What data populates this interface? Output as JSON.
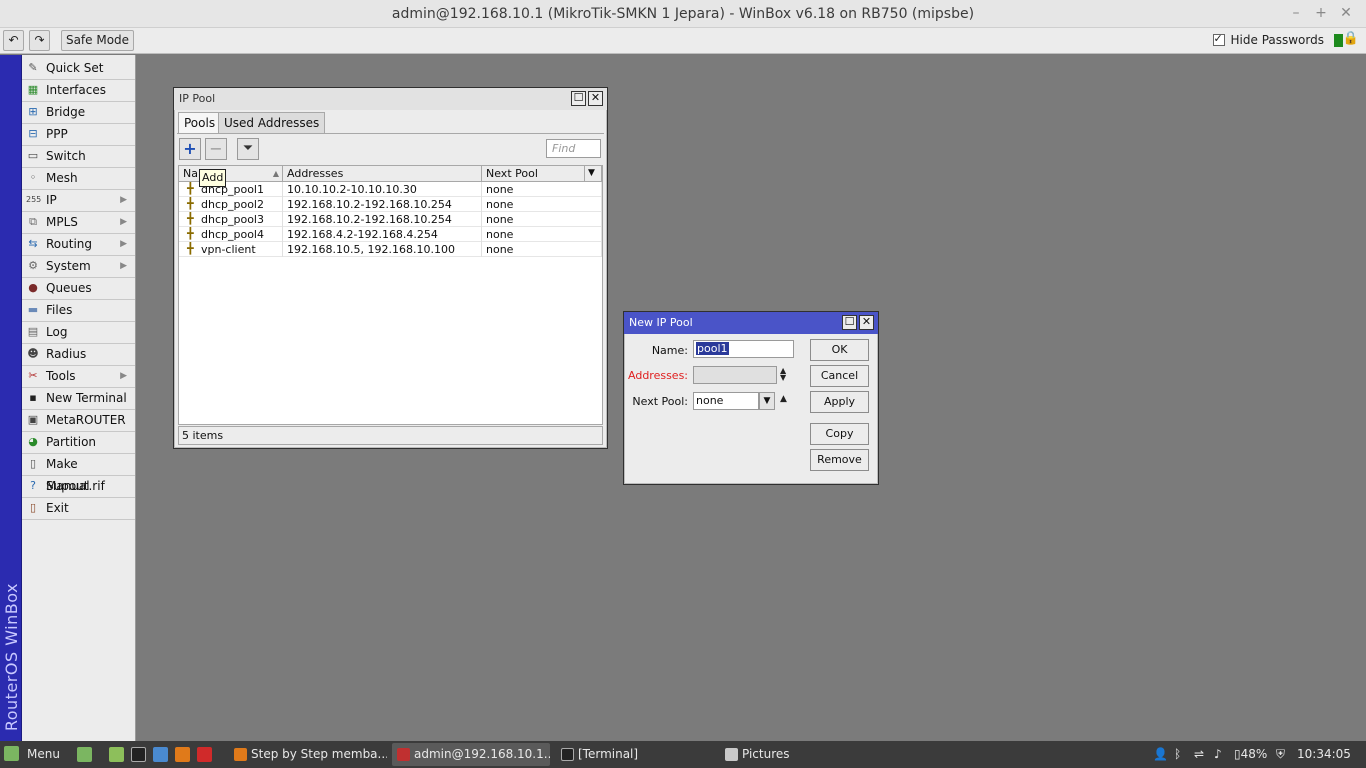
{
  "window": {
    "title": "admin@192.168.10.1 (MikroTik-SMKN 1 Jepara) - WinBox v6.18 on RB750 (mipsbe)"
  },
  "toolbar": {
    "undo_icon": "undo-icon",
    "redo_icon": "redo-icon",
    "safe_mode_label": "Safe Mode",
    "hide_passwords_label": "Hide Passwords",
    "hide_passwords_checked": true
  },
  "sidebar": {
    "brand": "RouterOS WinBox",
    "items": [
      {
        "label": "Quick Set",
        "icon": "wand-icon",
        "arrow": false
      },
      {
        "label": "Interfaces",
        "icon": "interfaces-icon",
        "arrow": false
      },
      {
        "label": "Bridge",
        "icon": "bridge-icon",
        "arrow": false
      },
      {
        "label": "PPP",
        "icon": "ppp-icon",
        "arrow": false
      },
      {
        "label": "Switch",
        "icon": "switch-icon",
        "arrow": false
      },
      {
        "label": "Mesh",
        "icon": "mesh-icon",
        "arrow": false
      },
      {
        "label": "IP",
        "icon": "ip-icon",
        "arrow": true
      },
      {
        "label": "MPLS",
        "icon": "mpls-icon",
        "arrow": true
      },
      {
        "label": "Routing",
        "icon": "routing-icon",
        "arrow": true
      },
      {
        "label": "System",
        "icon": "gear-icon",
        "arrow": true
      },
      {
        "label": "Queues",
        "icon": "queues-icon",
        "arrow": false
      },
      {
        "label": "Files",
        "icon": "folder-icon",
        "arrow": false
      },
      {
        "label": "Log",
        "icon": "log-icon",
        "arrow": false
      },
      {
        "label": "Radius",
        "icon": "radius-icon",
        "arrow": false
      },
      {
        "label": "Tools",
        "icon": "tools-icon",
        "arrow": true
      },
      {
        "label": "New Terminal",
        "icon": "terminal-icon",
        "arrow": false
      },
      {
        "label": "MetaROUTER",
        "icon": "metarouter-icon",
        "arrow": false
      },
      {
        "label": "Partition",
        "icon": "partition-icon",
        "arrow": false
      },
      {
        "label": "Make Supout.rif",
        "icon": "document-icon",
        "arrow": false
      },
      {
        "label": "Manual",
        "icon": "help-icon",
        "arrow": false
      },
      {
        "label": "Exit",
        "icon": "exit-icon",
        "arrow": false
      }
    ]
  },
  "ip_pool": {
    "title": "IP Pool",
    "tabs": [
      "Pools",
      "Used Addresses"
    ],
    "active_tab": "Pools",
    "find_placeholder": "Find",
    "tooltip": "Add",
    "columns": [
      "Name",
      "Addresses",
      "Next Pool"
    ],
    "rows": [
      {
        "name": "dhcp_pool1",
        "addresses": "10.10.10.2-10.10.10.30",
        "next_pool": "none"
      },
      {
        "name": "dhcp_pool2",
        "addresses": "192.168.10.2-192.168.10.254",
        "next_pool": "none"
      },
      {
        "name": "dhcp_pool3",
        "addresses": "192.168.10.2-192.168.10.254",
        "next_pool": "none"
      },
      {
        "name": "dhcp_pool4",
        "addresses": "192.168.4.2-192.168.4.254",
        "next_pool": "none"
      },
      {
        "name": "vpn-client",
        "addresses": "192.168.10.5, 192.168.10.100",
        "next_pool": "none"
      }
    ],
    "status": "5 items"
  },
  "new_pool": {
    "title": "New IP Pool",
    "name_label": "Name:",
    "name_value": "pool1",
    "addresses_label": "Addresses:",
    "addresses_value": "",
    "next_pool_label": "Next Pool:",
    "next_pool_value": "none",
    "buttons": {
      "ok": "OK",
      "cancel": "Cancel",
      "apply": "Apply",
      "copy": "Copy",
      "remove": "Remove"
    },
    "colors": {
      "title_bg": "#4a54c8",
      "required_label": "#e02020"
    }
  },
  "taskbar": {
    "menu_label": "Menu",
    "tasks": [
      {
        "label": "Step by Step memba...",
        "icon": "firefox-icon",
        "active": false
      },
      {
        "label": "admin@192.168.10.1...",
        "icon": "winbox-icon",
        "active": true
      },
      {
        "label": "[Terminal]",
        "icon": "terminal-icon",
        "active": false
      },
      {
        "label": "Pictures",
        "icon": "folder-icon",
        "active": false
      }
    ],
    "battery": "48%",
    "clock": "10:34:05"
  }
}
